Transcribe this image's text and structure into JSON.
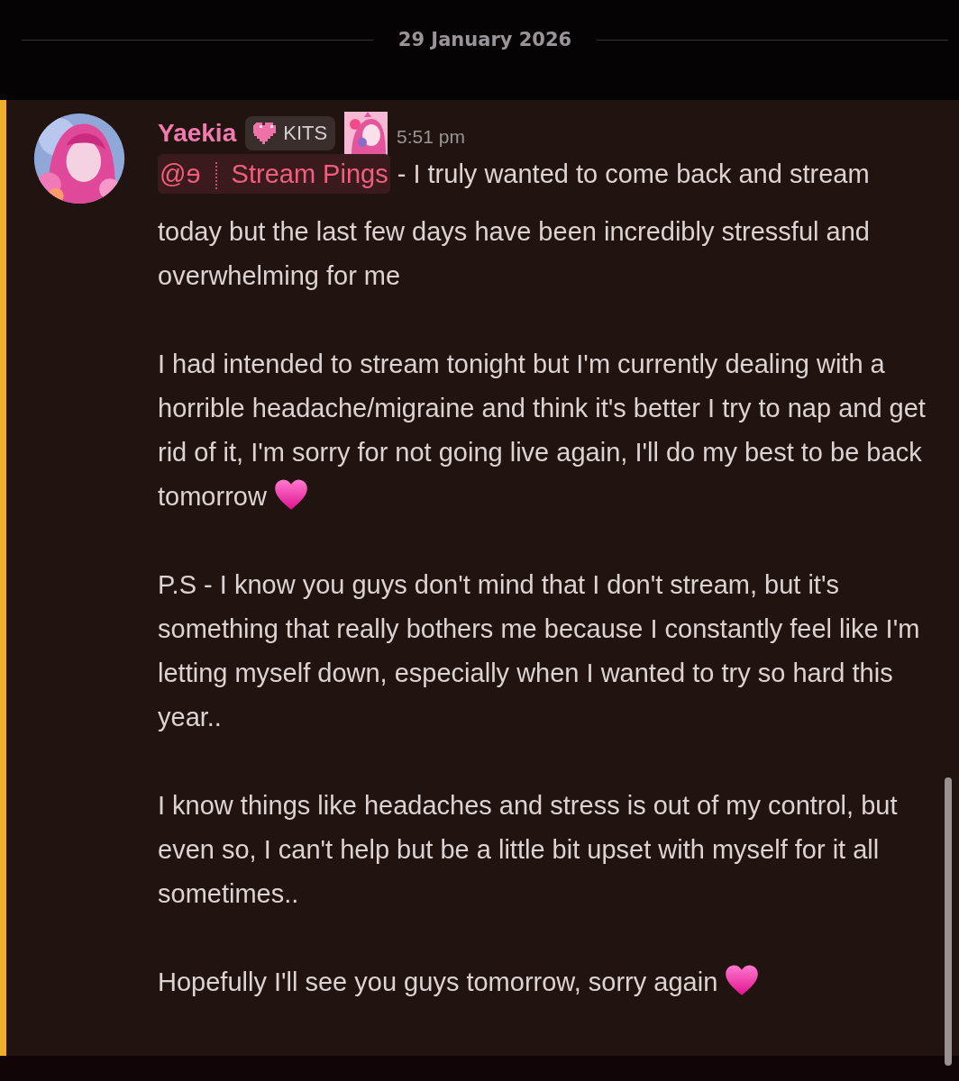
{
  "date_divider": {
    "label": "29 January 2026"
  },
  "message": {
    "author": "Yaekia",
    "role_badge": {
      "label": "KITS"
    },
    "timestamp": "5:51 pm",
    "mention": {
      "prefix": "@ɘ",
      "label": "Stream Pings"
    },
    "paragraphs": [
      {
        "text": "- I truly wanted to come back and stream today but the last few days have been incredibly stressful and overwhelming for me",
        "kind": "plain"
      },
      {
        "text": "I had intended to stream tonight but I'm currently dealing with a horrible headache/migraine and think it's better I try to nap and get rid of it, I'm sorry for not going live again, I'll do my best to be back tomorrow",
        "kind": "heart_end"
      },
      {
        "text": "P.S - I know you guys don't mind that I don't stream, but it's something that really bothers me because I constantly feel like I'm letting myself down, especially when I wanted to try so hard this year..",
        "kind": "plain"
      },
      {
        "text": "I know things like headaches and stress is out of my control, but even so, I can't help but be a little bit upset with myself for it all sometimes..",
        "kind": "plain"
      },
      {
        "text": "Hopefully I'll see you guys tomorrow, sorry again",
        "kind": "heart_end"
      }
    ]
  }
}
